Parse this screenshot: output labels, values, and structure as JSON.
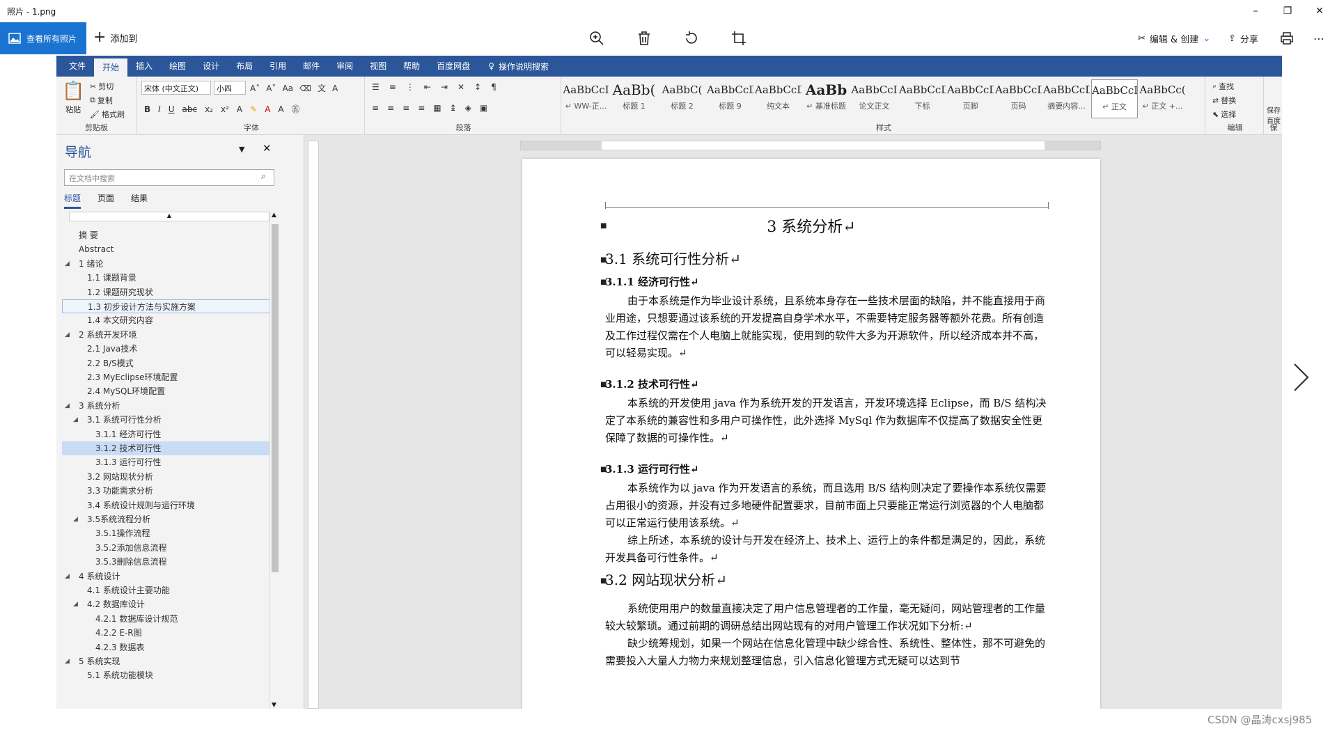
{
  "window": {
    "title": "照片 - 1.png",
    "minimize": "–",
    "maximize": "❐",
    "close": "✕"
  },
  "photos_toolbar": {
    "view_all": "查看所有照片",
    "add_to": "添加到",
    "edit_create": "编辑 & 创建",
    "share": "分享"
  },
  "word_tabs": [
    {
      "label": "文件"
    },
    {
      "label": "开始"
    },
    {
      "label": "插入"
    },
    {
      "label": "绘图"
    },
    {
      "label": "设计"
    },
    {
      "label": "布局"
    },
    {
      "label": "引用"
    },
    {
      "label": "邮件"
    },
    {
      "label": "审阅"
    },
    {
      "label": "视图"
    },
    {
      "label": "帮助"
    },
    {
      "label": "百度网盘"
    }
  ],
  "tell_me": "操作说明搜索",
  "ribbon": {
    "clipboard": {
      "paste": "粘贴",
      "cut": "剪切",
      "copy": "复制",
      "format_painter": "格式刷",
      "label": "剪贴板"
    },
    "font": {
      "name": "宋体 (中文正文)",
      "size": "小四",
      "label": "字体"
    },
    "paragraph": {
      "label": "段落"
    },
    "styles_label": "样式",
    "styles": [
      {
        "sample": "AaBbCcI",
        "name": "↵ WW-正..."
      },
      {
        "sample": "AaBb(",
        "name": "标题 1"
      },
      {
        "sample": "AaBbC(",
        "name": "标题 2"
      },
      {
        "sample": "AaBbCcD",
        "name": "标题 9"
      },
      {
        "sample": "AaBbCcD(",
        "name": "纯文本"
      },
      {
        "sample": "AaBb",
        "name": "↵ 基准标题"
      },
      {
        "sample": "AaBbCcI",
        "name": "论文正文"
      },
      {
        "sample": "AaBbCcDdI",
        "name": "下标"
      },
      {
        "sample": "AaBbCcDdI",
        "name": "页脚"
      },
      {
        "sample": "AaBbCcD",
        "name": "页码"
      },
      {
        "sample": "AaBbCcDdI",
        "name": "摘要内容..."
      },
      {
        "sample": "AaBbCcI",
        "name": "↵ 正文"
      },
      {
        "sample": "AaBbCc(",
        "name": "↵ 正文 +..."
      }
    ],
    "editing": {
      "find": "查找",
      "replace": "替换",
      "select": "选择",
      "label": "编辑"
    },
    "extra": {
      "save": "保存",
      "baidu": "百度",
      "save2": "保"
    }
  },
  "nav": {
    "title": "导航",
    "search_placeholder": "在文档中搜索",
    "tabs": [
      "标题",
      "页面",
      "结果"
    ],
    "outline": [
      {
        "text": "摘 要",
        "level": 0,
        "tri": ""
      },
      {
        "text": "Abstract",
        "level": 0,
        "tri": ""
      },
      {
        "text": "1 绪论",
        "level": 0,
        "tri": "◢"
      },
      {
        "text": "1.1 课题背景",
        "level": 1,
        "tri": ""
      },
      {
        "text": "1.2 课题研究现状",
        "level": 1,
        "tri": ""
      },
      {
        "text": "1.3 初步设计方法与实施方案",
        "level": 1,
        "tri": "",
        "box": true
      },
      {
        "text": "1.4 本文研究内容",
        "level": 1,
        "tri": ""
      },
      {
        "text": "2 系统开发环境",
        "level": 0,
        "tri": "◢"
      },
      {
        "text": "2.1 Java技术",
        "level": 1,
        "tri": ""
      },
      {
        "text": "2.2 B/S模式",
        "level": 1,
        "tri": ""
      },
      {
        "text": "2.3 MyEclipse环境配置",
        "level": 1,
        "tri": ""
      },
      {
        "text": "2.4 MySQL环境配置",
        "level": 1,
        "tri": ""
      },
      {
        "text": "3 系统分析",
        "level": 0,
        "tri": "◢"
      },
      {
        "text": "3.1 系统可行性分析",
        "level": 1,
        "tri": "◢"
      },
      {
        "text": "3.1.1 经济可行性",
        "level": 2,
        "tri": ""
      },
      {
        "text": "3.1.2 技术可行性",
        "level": 2,
        "tri": "",
        "hl": true
      },
      {
        "text": "3.1.3 运行可行性",
        "level": 2,
        "tri": ""
      },
      {
        "text": "3.2 网站现状分析",
        "level": 1,
        "tri": ""
      },
      {
        "text": "3.3 功能需求分析",
        "level": 1,
        "tri": ""
      },
      {
        "text": "3.4 系统设计规则与运行环境",
        "level": 1,
        "tri": ""
      },
      {
        "text": "3.5系统流程分析",
        "level": 1,
        "tri": "◢"
      },
      {
        "text": "3.5.1操作流程",
        "level": 2,
        "tri": ""
      },
      {
        "text": "3.5.2添加信息流程",
        "level": 2,
        "tri": ""
      },
      {
        "text": "3.5.3删除信息流程",
        "level": 2,
        "tri": ""
      },
      {
        "text": "4 系统设计",
        "level": 0,
        "tri": "◢"
      },
      {
        "text": "4.1 系统设计主要功能",
        "level": 1,
        "tri": ""
      },
      {
        "text": "4.2 数据库设计",
        "level": 1,
        "tri": "◢"
      },
      {
        "text": "4.2.1 数据库设计规范",
        "level": 2,
        "tri": ""
      },
      {
        "text": "4.2.2 E-R图",
        "level": 2,
        "tri": ""
      },
      {
        "text": "4.2.3 数据表",
        "level": 2,
        "tri": ""
      },
      {
        "text": "5 系统实现",
        "level": 0,
        "tri": "◢"
      },
      {
        "text": "5.1 系统功能模块",
        "level": 1,
        "tri": ""
      }
    ]
  },
  "doc": {
    "h1": "3  系统分析↵",
    "s31": "3.1  系统可行性分析↵",
    "s311": "3.1.1  经济可行性↵",
    "p311": "由于本系统是作为毕业设计系统，且系统本身存在一些技术层面的缺陷，并不能直接用于商业用途，只想要通过该系统的开发提高自身学术水平，不需要特定服务器等额外花费。所有创造及工作过程仅需在个人电脑上就能实现，使用到的软件大多为开源软件，所以经济成本并不高，可以轻易实现。↵",
    "s312": "3.1.2  技术可行性↵",
    "p312": "本系统的开发使用 java 作为系统开发的开发语言，开发环境选择 Eclipse，而 B/S 结构决定了本系统的兼容性和多用户可操作性，此外选择 MySql 作为数据库不仅提高了数据安全性更保障了数据的可操作性。↵",
    "s313": "3.1.3  运行可行性↵",
    "p313a": "本系统作为以 java 作为开发语言的系统，而且选用 B/S 结构则决定了要操作本系统仅需要占用很小的资源，并没有过多地硬件配置要求，目前市面上只要能正常运行浏览器的个人电脑都可以正常运行使用该系统。↵",
    "p313b": "综上所述，本系统的设计与开发在经济上、技术上、运行上的条件都是满足的，因此，系统开发具备可行性条件。↵",
    "s32": "3.2  网站现状分析↵",
    "p32a": "系统使用用户的数量直接决定了用户信息管理者的工作量，毫无疑问，网站管理者的工作量较大较繁琐。通过前期的调研总结出网站现有的对用户管理工作状况如下分析:↵",
    "p32b": "缺少统筹规划，如果一个网站在信息化管理中缺少综合性、系统性、整体性，那不可避免的需要投入大量人力物力来规划整理信息，引入信息化管理方式无疑可以达到节"
  },
  "watermark": "CSDN @晶涛cxsj985"
}
